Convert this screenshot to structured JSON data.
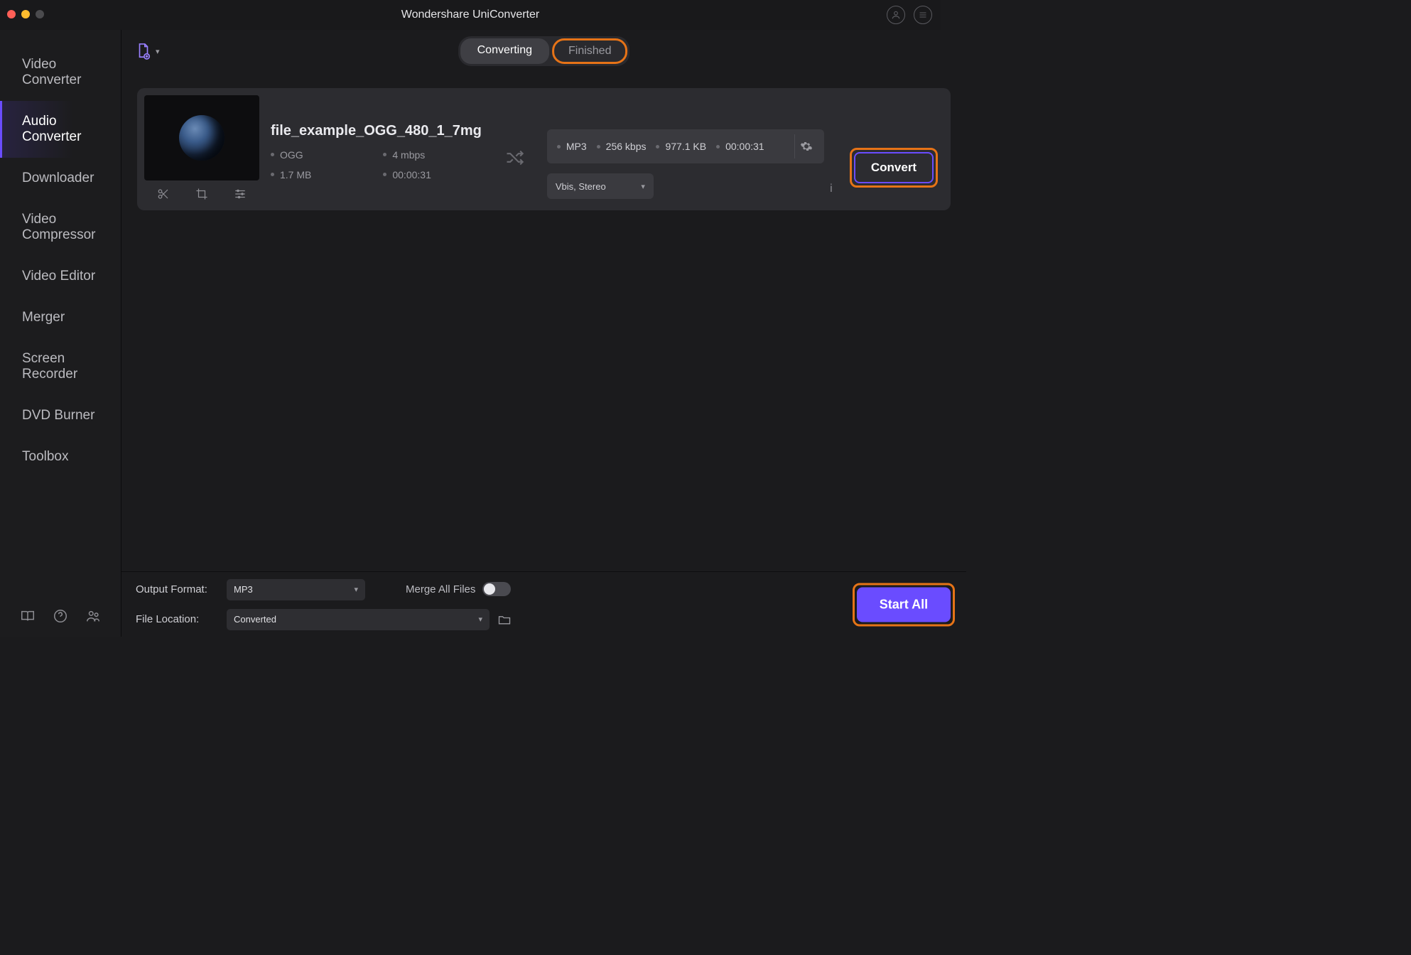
{
  "window": {
    "title": "Wondershare UniConverter"
  },
  "sidebar": {
    "items": [
      {
        "label": "Video Converter"
      },
      {
        "label": "Audio Converter"
      },
      {
        "label": "Downloader"
      },
      {
        "label": "Video Compressor"
      },
      {
        "label": "Video Editor"
      },
      {
        "label": "Merger"
      },
      {
        "label": "Screen Recorder"
      },
      {
        "label": "DVD Burner"
      },
      {
        "label": "Toolbox"
      }
    ],
    "active_index": 1
  },
  "tabs": {
    "items": [
      {
        "label": "Converting"
      },
      {
        "label": "Finished"
      }
    ],
    "selected_index": 0,
    "highlighted_index": 1
  },
  "file": {
    "name": "file_example_OGG_480_1_7mg",
    "source": {
      "format": "OGG",
      "bitrate": "4 mbps",
      "filesize": "1.7 MB",
      "duration": "00:00:31"
    },
    "target": {
      "format": "MP3",
      "bitrate": "256 kbps",
      "filesize": "977.1 KB",
      "duration": "00:00:31"
    },
    "audio_track": "Vbis, Stereo",
    "convert_label": "Convert"
  },
  "footer": {
    "output_format_label": "Output Format:",
    "output_format_value": "MP3",
    "file_location_label": "File Location:",
    "file_location_value": "Converted",
    "merge_label": "Merge All Files",
    "start_all_label": "Start All"
  }
}
